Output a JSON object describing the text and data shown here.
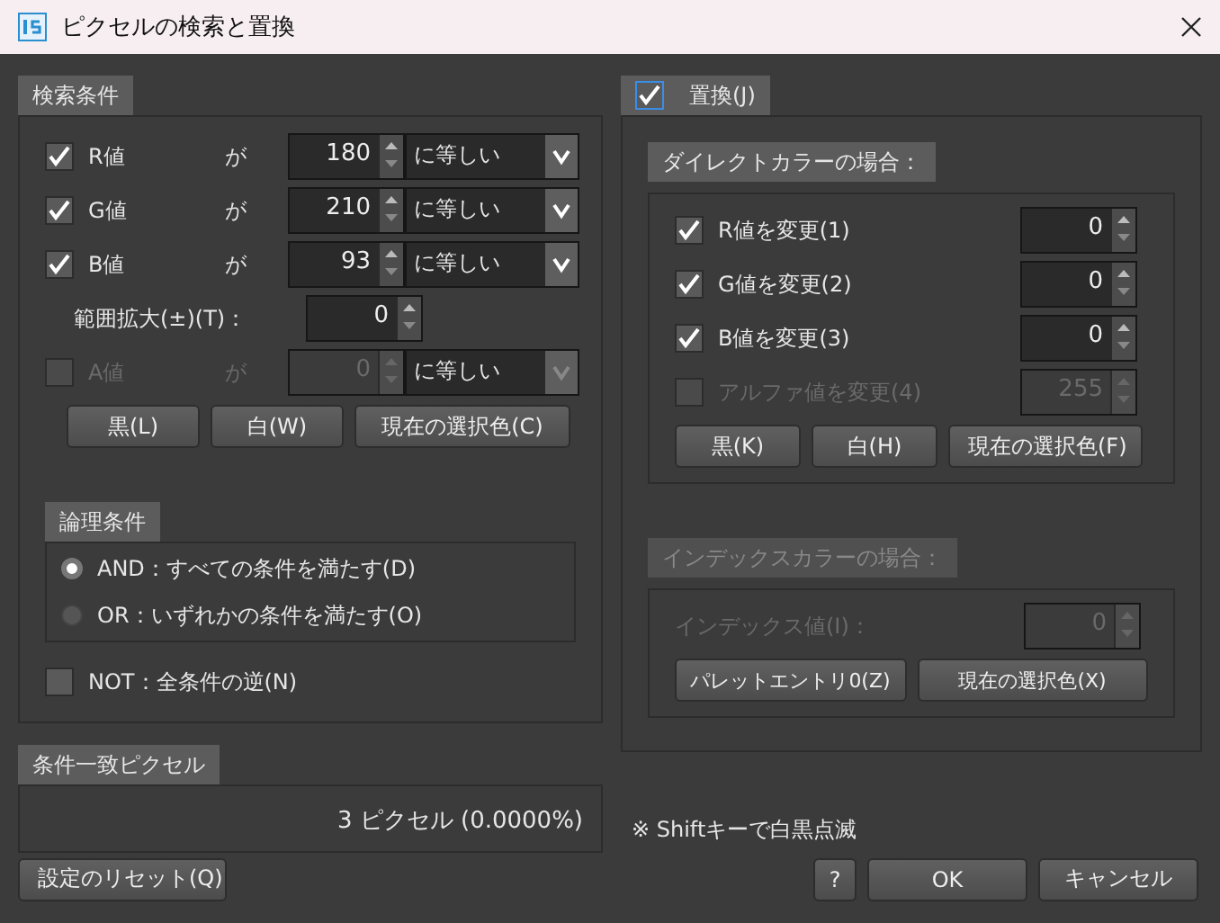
{
  "window": {
    "title": "ピクセルの検索と置換"
  },
  "search": {
    "title": "検索条件",
    "conditions": [
      {
        "label": "R値",
        "checked": true,
        "disabled": false,
        "op": "が",
        "value": "180",
        "mode": "に等しい"
      },
      {
        "label": "G値",
        "checked": true,
        "disabled": false,
        "op": "が",
        "value": "210",
        "mode": "に等しい"
      },
      {
        "label": "B値",
        "checked": true,
        "disabled": false,
        "op": "が",
        "value": "93",
        "mode": "に等しい"
      },
      {
        "label": "A値",
        "checked": false,
        "disabled": true,
        "op": "が",
        "value": "0",
        "mode": "に等しい"
      }
    ],
    "range": {
      "label": "範囲拡大(±)(T)：",
      "value": "0"
    },
    "buttons": [
      "黒(L)",
      "白(W)",
      "現在の選択色(C)"
    ],
    "logic": {
      "title": "論理条件",
      "options": [
        {
          "label": "AND：すべての条件を満たす(D)",
          "selected": true
        },
        {
          "label": "OR：いずれかの条件を満たす(O)",
          "selected": false
        }
      ]
    },
    "not": {
      "label": "NOT：全条件の逆(N)",
      "checked": false
    }
  },
  "matched": {
    "title": "条件一致ピクセル",
    "value": "3 ピクセル (0.0000%)"
  },
  "replace": {
    "title": "置換(J)",
    "checked": true,
    "direct": {
      "title": "ダイレクトカラーの場合：",
      "channels": [
        {
          "label": "R値を変更(1)",
          "checked": true,
          "disabled": false,
          "value": "0"
        },
        {
          "label": "G値を変更(2)",
          "checked": true,
          "disabled": false,
          "value": "0"
        },
        {
          "label": "B値を変更(3)",
          "checked": true,
          "disabled": false,
          "value": "0"
        },
        {
          "label": "アルファ値を変更(4)",
          "checked": false,
          "disabled": true,
          "value": "255"
        }
      ],
      "buttons": [
        "黒(K)",
        "白(H)",
        "現在の選択色(F)"
      ]
    },
    "index": {
      "title": "インデックスカラーの場合：",
      "disabled": true,
      "label": "インデックス値(I)：",
      "value": "0",
      "buttons": [
        "パレットエントリ0(Z)",
        "現在の選択色(X)"
      ]
    }
  },
  "hint": "※ Shiftキーで白黒点滅",
  "footer": {
    "reset": "設定のリセット(Q)",
    "help": "?",
    "ok": "OK",
    "cancel": "キャンセル"
  }
}
